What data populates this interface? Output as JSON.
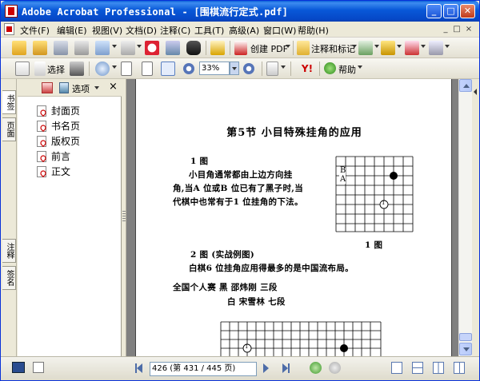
{
  "window": {
    "title": "Adobe Acrobat Professional - [围棋流行定式.pdf]",
    "minimize_glyph": "_",
    "maximize_glyph": "□",
    "close_glyph": "✕"
  },
  "menubar": {
    "items": [
      {
        "label": "文件(F)"
      },
      {
        "label": "编辑(E)"
      },
      {
        "label": "视图(V)"
      },
      {
        "label": "文档(D)"
      },
      {
        "label": "注释(C)"
      },
      {
        "label": "工具(T)"
      },
      {
        "label": "高级(A)"
      },
      {
        "label": "窗口(W)"
      },
      {
        "label": "帮助(H)"
      }
    ],
    "mdi_minimize": "_",
    "mdi_restore": "□",
    "mdi_close": "×"
  },
  "toolbar1": {
    "create_pdf_label": "创建 PDF",
    "comment_label": "注释和标记"
  },
  "toolbar2": {
    "select_label": "选择",
    "zoom_value": "33%",
    "help_label": "帮助"
  },
  "nav_panel": {
    "tabs": [
      "书签",
      "页面",
      "注释",
      "签名"
    ],
    "options_label": "选项",
    "close_glyph": "×",
    "bookmarks": [
      {
        "label": "封面页"
      },
      {
        "label": "书名页"
      },
      {
        "label": "版权页"
      },
      {
        "label": "前言"
      },
      {
        "label": "正文"
      }
    ]
  },
  "page": {
    "heading": "第5节    小目特殊挂角的应用",
    "fig1_label": "1 图",
    "para1_line1": "小目角通常都由上边方向挂",
    "para1_line2": "角,当A 位或B 位已有了黑子时,当",
    "para1_line3": "代棋中也常有于1 位挂角的下法。",
    "board_B": "B",
    "board_A": "A",
    "board_1": "1",
    "board_caption": "1 图",
    "fig2_label": "2 图 (实战例图)",
    "para2": "白棋6 位挂角应用得最多的是中国流布局。",
    "game_line1": "全国个人赛    黑    邵炜刚    三段",
    "game_line2": "白    宋雪林    七段",
    "board2_mark": "1"
  },
  "statusbar": {
    "page_field": "426 (第 431 / 445 页)"
  },
  "colors": {
    "titlebar": "#0858d8",
    "chrome": "#ece9d8",
    "doc_bg": "#808080"
  }
}
